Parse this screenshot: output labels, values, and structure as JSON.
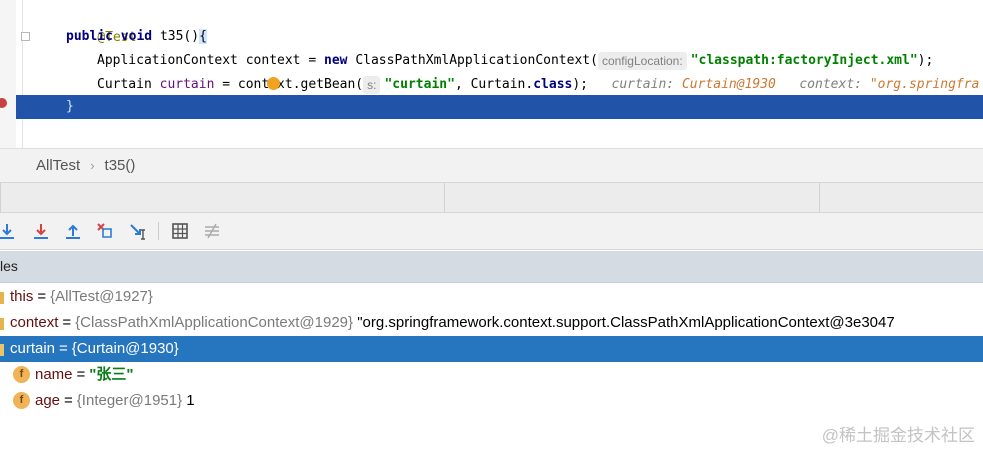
{
  "editor": {
    "line1": {
      "annotation": "@Test"
    },
    "line2": {
      "kw1": "public",
      "kw2": "void",
      "method": "t35",
      "paren": "()",
      "brace": "{"
    },
    "line3": {
      "type": "ApplicationContext",
      "var": "context",
      "eq": "=",
      "kw_new": "new",
      "ctor": "ClassPathXmlApplicationContext(",
      "hint": "configLocation:",
      "arg": "\"classpath:factoryInject.xml\"",
      "end": ");"
    },
    "line4": {
      "type": "Curtain",
      "var": "curtain",
      "eq": "=",
      "call_a": "con",
      "call_b": "text.getBean(",
      "hint": "s:",
      "arg": "\"curtain\"",
      "comma": ", Curtain.",
      "kw_class": "class",
      "end": ");",
      "inline1_key": "curtain:",
      "inline1_val": "Curtain@1930",
      "inline2_key": "context:",
      "inline2_val": "\"org.springfra"
    },
    "line5": {
      "brace": "}"
    },
    "line6": {
      "brace": "}"
    }
  },
  "breadcrumb": {
    "class_name": "AllTest",
    "separator": "›",
    "method_name": "t35()"
  },
  "toolbar": {
    "icons": [
      "step-over-icon",
      "step-into-icon",
      "step-out-icon",
      "drop-frame-icon",
      "run-to-cursor-icon",
      "evaluate-icon",
      "trace-icon"
    ]
  },
  "variables": {
    "header": "les",
    "rows": [
      {
        "name": "this",
        "value": "{AllTest@1927}",
        "extra": ""
      },
      {
        "name": "context",
        "value": "{ClassPathXmlApplicationContext@1929}",
        "extra": "\"org.springframework.context.support.ClassPathXmlApplicationContext@3e3047"
      },
      {
        "name": "curtain",
        "value": "{Curtain@1930}",
        "extra": ""
      },
      {
        "name": "name",
        "value": "",
        "extra": "\"张三\""
      },
      {
        "name": "age",
        "value": "{Integer@1951}",
        "extra": "1"
      }
    ],
    "field_badge": "f"
  },
  "watermark": "@稀土掘金技术社区",
  "colors": {
    "selection": "#2675bf",
    "current_line": "#2154a8",
    "keyword": "#000080",
    "string": "#008000"
  }
}
